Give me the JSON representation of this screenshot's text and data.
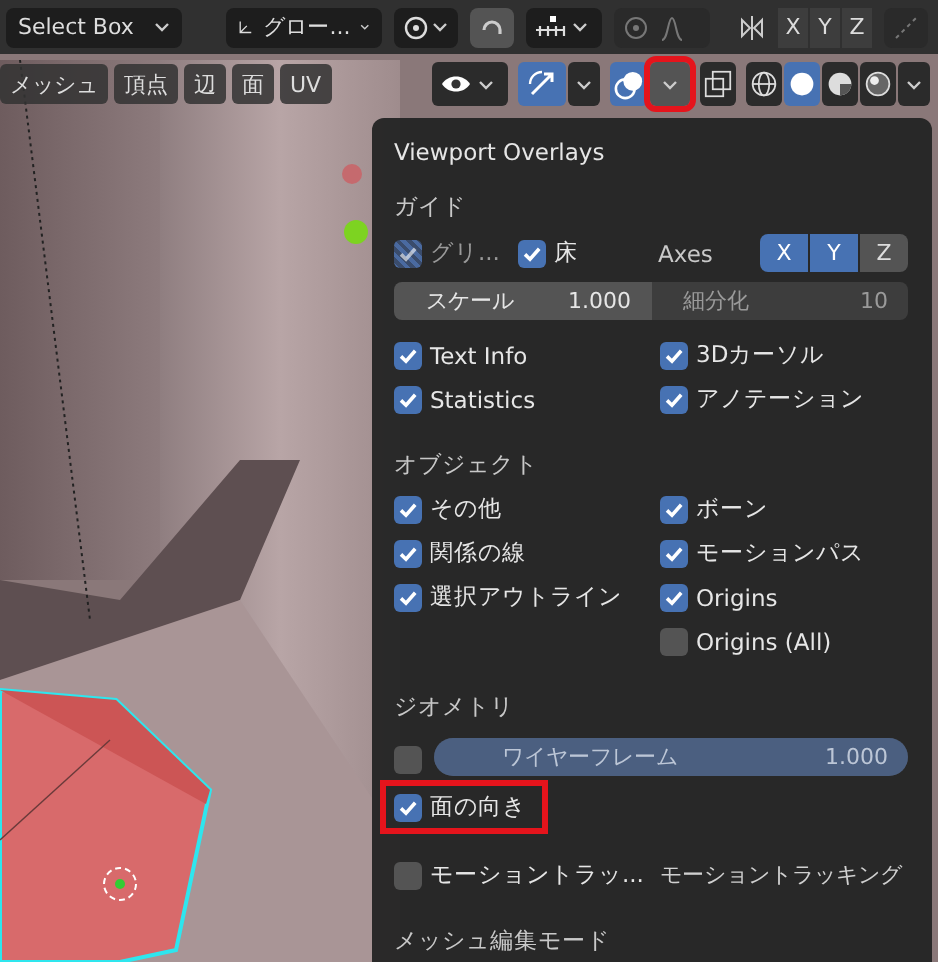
{
  "header": {
    "select_tool": "Select Box",
    "orientation": "グロー...",
    "mirror_axes": [
      "X",
      "Y",
      "Z"
    ]
  },
  "edit_menus": [
    "メッシュ",
    "頂点",
    "辺",
    "面",
    "UV"
  ],
  "viewport_toggles": {
    "gizmos_on": true,
    "overlays_on": true,
    "overlay_menu_highlighted": true
  },
  "shading_modes": [
    {
      "selected": false
    },
    {
      "selected": true
    },
    {
      "selected": false
    },
    {
      "selected": false
    }
  ],
  "popup": {
    "title": "Viewport Overlays",
    "sections": [
      {
        "heading": "ガイド",
        "blocks": [
          {
            "kind": "row",
            "cells": [
              {
                "kind": "check",
                "label": "グリ...",
                "checked": true,
                "disabled": true
              },
              {
                "kind": "check",
                "label": "床",
                "checked": true,
                "disabled": false
              },
              {
                "kind": "axes",
                "label": "Axes",
                "buttons": [
                  {
                    "label": "X",
                    "selected": true
                  },
                  {
                    "label": "Y",
                    "selected": true
                  },
                  {
                    "label": "Z",
                    "selected": false
                  }
                ]
              }
            ]
          },
          {
            "kind": "row",
            "cells": [
              {
                "kind": "number",
                "label": "スケール",
                "value": "1.000",
                "disabled": false
              },
              {
                "kind": "number",
                "label": "細分化",
                "value": "10",
                "disabled": true
              }
            ]
          },
          {
            "kind": "columns",
            "left": [
              {
                "kind": "check",
                "label": "Text Info",
                "checked": true,
                "disabled": false
              },
              {
                "kind": "check",
                "label": "Statistics",
                "checked": true,
                "disabled": false
              }
            ],
            "right": [
              {
                "kind": "check",
                "label": "3Dカーソル",
                "checked": true,
                "disabled": false
              },
              {
                "kind": "check",
                "label": "アノテーション",
                "checked": true,
                "disabled": false
              }
            ]
          }
        ]
      },
      {
        "heading": "オブジェクト",
        "blocks": [
          {
            "kind": "columns",
            "left": [
              {
                "kind": "check",
                "label": "その他",
                "checked": true,
                "disabled": false
              },
              {
                "kind": "check",
                "label": "関係の線",
                "checked": true,
                "disabled": false
              },
              {
                "kind": "check",
                "label": "選択アウトライン",
                "checked": true,
                "disabled": false
              }
            ],
            "right": [
              {
                "kind": "check",
                "label": "ボーン",
                "checked": true,
                "disabled": false
              },
              {
                "kind": "check",
                "label": "モーションパス",
                "checked": true,
                "disabled": false
              },
              {
                "kind": "check",
                "label": "Origins",
                "checked": true,
                "disabled": false
              },
              {
                "kind": "check",
                "label": "Origins (All)",
                "checked": false,
                "disabled": false
              }
            ]
          }
        ]
      },
      {
        "heading": "ジオメトリ",
        "blocks": [
          {
            "kind": "row",
            "cells": [
              {
                "kind": "check",
                "checked": false,
                "disabled": false
              },
              {
                "kind": "slider",
                "label": "ワイヤーフレーム",
                "value": "1.000",
                "level": 1
              }
            ]
          },
          {
            "kind": "row",
            "cells": [
              {
                "kind": "check",
                "label": "面の向き",
                "checked": true,
                "disabled": false,
                "highlighted": true
              }
            ]
          }
        ]
      },
      {
        "blocks": [
          {
            "kind": "row",
            "cells": [
              {
                "kind": "check",
                "label": "モーショントラッ...",
                "checked": false,
                "disabled": false
              },
              {
                "kind": "menu",
                "label": "モーショントラッキング"
              }
            ]
          }
        ]
      },
      {
        "heading": "メッシュ編集モード"
      }
    ]
  }
}
